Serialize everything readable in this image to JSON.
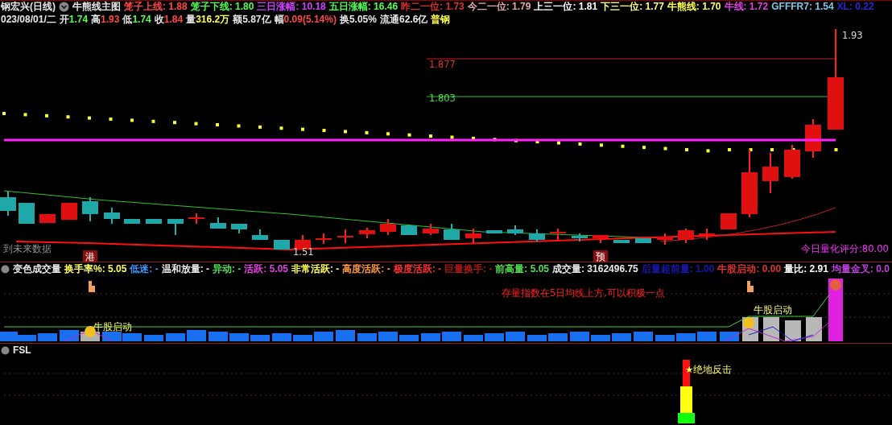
{
  "header": {
    "title": "钢宏兴(日线)",
    "chart_name": "牛熊线主图",
    "indicators": [
      {
        "text": "笼子上线: 1.88",
        "color": "#ff4848"
      },
      {
        "text": "笼子下线: 1.80",
        "color": "#50ff50"
      },
      {
        "text": "三日涨幅: 10.18",
        "color": "#d040ff"
      },
      {
        "text": "五日涨幅: 16.46",
        "color": "#50ff50"
      },
      {
        "text": "昨二一位: 1.73",
        "color": "#e03030"
      },
      {
        "text": "今二一位: 1.79",
        "color": "#e0a8a8"
      },
      {
        "text": "上三一位: 1.81",
        "color": "#ffffff"
      },
      {
        "text": "下三一位: 1.77",
        "color": "#ffff80"
      },
      {
        "text": "牛熊线: 1.70",
        "color": "#ffff50"
      },
      {
        "text": "牛线: 1.72",
        "color": "#e040e0"
      },
      {
        "text": "GFFFR7: 1.54",
        "color": "#80c8e8"
      },
      {
        "text": "XL: 0.22",
        "color": "#2828d8"
      }
    ]
  },
  "quote": {
    "date": "023/08/01/二",
    "fields": [
      {
        "label": "开",
        "value": "1.74",
        "color": "#50ff50"
      },
      {
        "label": "高",
        "value": "1.93",
        "color": "#ff4848"
      },
      {
        "label": "低",
        "value": "1.74",
        "color": "#50ff50"
      },
      {
        "label": "收",
        "value": "1.84",
        "color": "#ff4848"
      },
      {
        "label": "量",
        "value": "316.2万",
        "color": "#ffff50"
      },
      {
        "label": "额",
        "value": "5.87亿",
        "color": "#e8e8e8"
      },
      {
        "label": "幅",
        "value": "0.09(5.14%)",
        "color": "#ff4848"
      },
      {
        "label": "换",
        "value": "5.05%",
        "color": "#e8e8e8"
      },
      {
        "label": "流通",
        "value": "62.6亿",
        "color": "#e8e8e8"
      }
    ],
    "sector": "普钢"
  },
  "main_chart": {
    "price_labels": [
      "1.877",
      "1.803",
      "1.93",
      "1.51"
    ],
    "future_note": "到未来数据",
    "score": "今日量化评分:80.00",
    "markers": [
      "港",
      "预"
    ]
  },
  "volume_panel": {
    "name": "变色成交量",
    "indicators": [
      {
        "text": "换手率%: 5.05",
        "color": "#ffff60"
      },
      {
        "text": "低迷: -",
        "color": "#3898ff"
      },
      {
        "text": "温和放量: -",
        "color": "#e8e8e8"
      },
      {
        "text": "异动: -",
        "color": "#50e050"
      },
      {
        "text": "活跃: 5.05",
        "color": "#e040e0"
      },
      {
        "text": "非常活跃: -",
        "color": "#ffff60"
      },
      {
        "text": "高度活跃: -",
        "color": "#ff9840"
      },
      {
        "text": "极度活跃: -",
        "color": "#ff3030"
      },
      {
        "text": "巨量换手: -",
        "color": "#b01818"
      },
      {
        "text": "前高量: 5.05",
        "color": "#50e050"
      },
      {
        "text": "成交量: 3162496.75",
        "color": "#e8e8e8"
      },
      {
        "text": "后量超前量: 1.00",
        "color": "#1818b0"
      },
      {
        "text": "牛股启动: 0.00",
        "color": "#e03030"
      },
      {
        "text": "量比: 2.91",
        "color": "#ffffff"
      },
      {
        "text": "均量金叉: 0.0",
        "color": "#c040e0"
      }
    ],
    "note": "存量指数在5日均线上方,可以积极一点",
    "signals": [
      "牛股启动",
      "牛股启动"
    ]
  },
  "fsl_panel": {
    "name": "FSL",
    "signal": "★绝地反击"
  }
}
